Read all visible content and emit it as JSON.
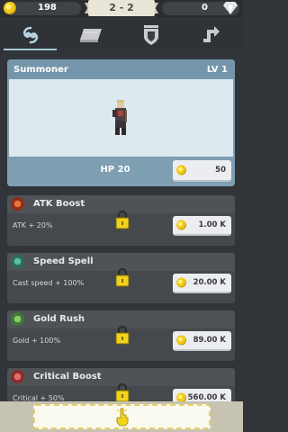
{
  "resources": {
    "gold": "198",
    "gems": "0"
  },
  "stage": "2 - 2",
  "tabs": [
    {
      "id": "skills",
      "icon": "swirl-icon",
      "active": true
    },
    {
      "id": "inventory",
      "icon": "book-icon",
      "active": false
    },
    {
      "id": "armor",
      "icon": "shield-icon",
      "active": false
    },
    {
      "id": "upgrade",
      "icon": "arrow-up-right-icon",
      "active": false
    }
  ],
  "hero": {
    "name": "Summoner",
    "level": "LV 1",
    "hp": "HP 20",
    "upgrade_cost": "50"
  },
  "upgrades": [
    {
      "title": "ATK Boost",
      "desc": "ATK + 20%",
      "cost": "1.00 K",
      "icon": "flame-icon",
      "locked": true
    },
    {
      "title": "Speed Spell",
      "desc": "Cast speed + 100%",
      "cost": "20.00 K",
      "icon": "hourglass-icon",
      "locked": true
    },
    {
      "title": "Gold Rush",
      "desc": "Gold + 100%",
      "cost": "89.00 K",
      "icon": "gold-bag-icon",
      "locked": true
    },
    {
      "title": "Critical Boost",
      "desc": "Critical + 50%",
      "cost": "560.00 K",
      "icon": "critical-icon",
      "locked": true
    }
  ],
  "colors": {
    "gold": "#f2c81a",
    "panel": "#7c9db0",
    "background": "#313438"
  }
}
